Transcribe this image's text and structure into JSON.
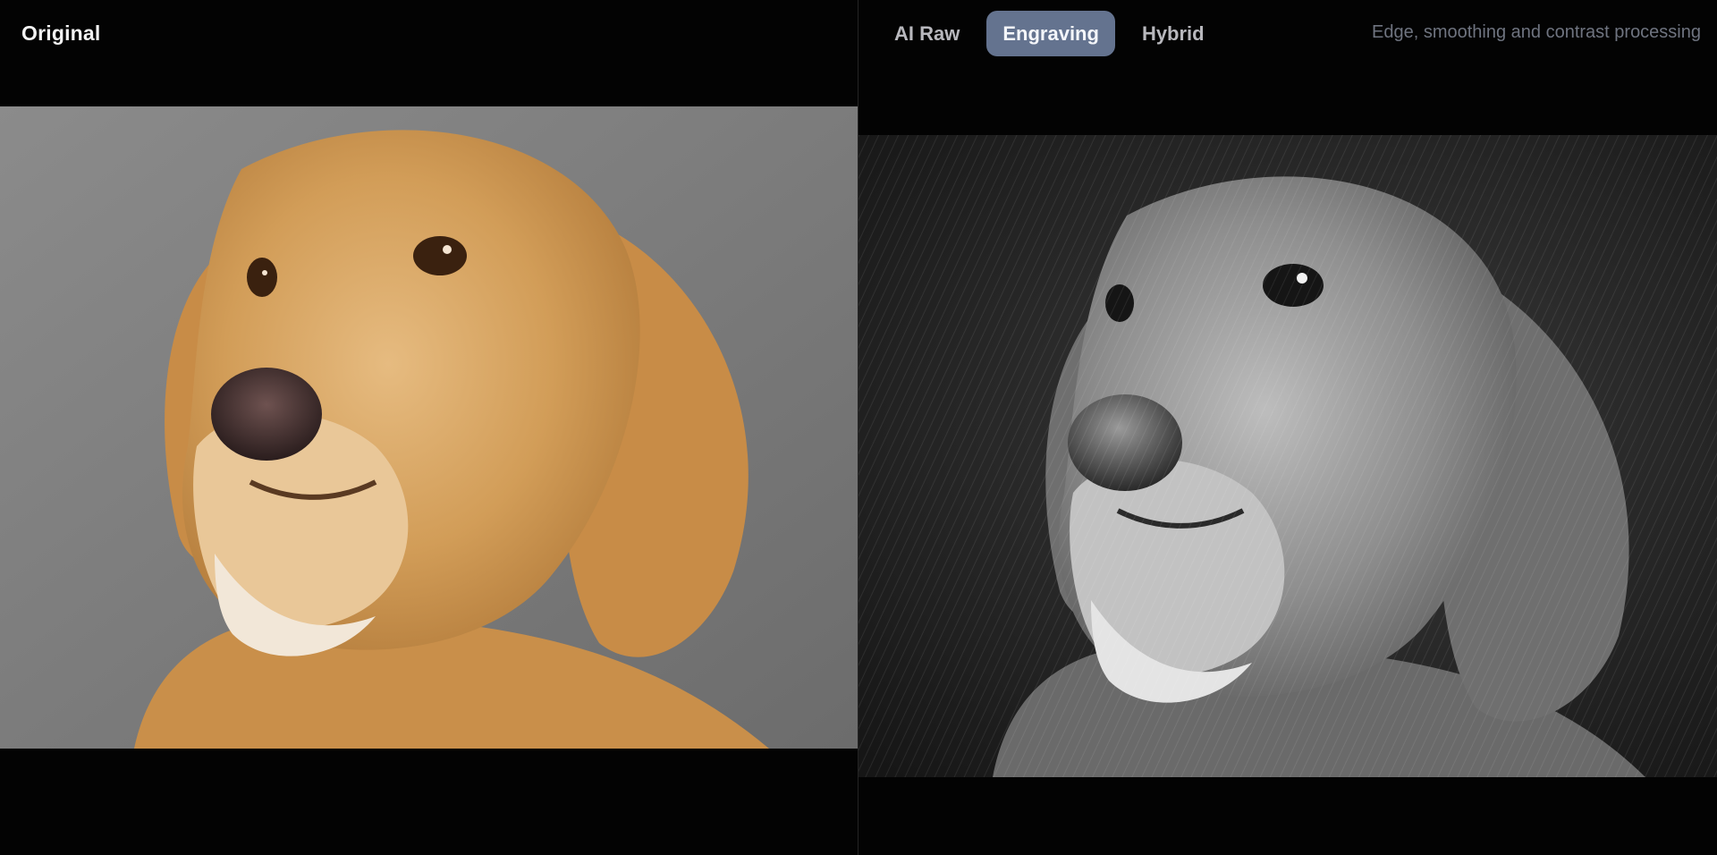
{
  "left_panel": {
    "title": "Original",
    "image": {
      "icon": "golden-retriever-photo",
      "description_visible": false
    }
  },
  "right_panel": {
    "tabs": [
      {
        "label": "AI Raw",
        "active": false
      },
      {
        "label": "Engraving",
        "active": true
      },
      {
        "label": "Hybrid",
        "active": false
      }
    ],
    "caption": "Edge, smoothing and contrast processing",
    "image": {
      "icon": "engraved-dog-image"
    }
  },
  "colors": {
    "background": "#030303",
    "active_tab": "#64738f",
    "caption": "#6f7480",
    "divider": "#242424"
  }
}
